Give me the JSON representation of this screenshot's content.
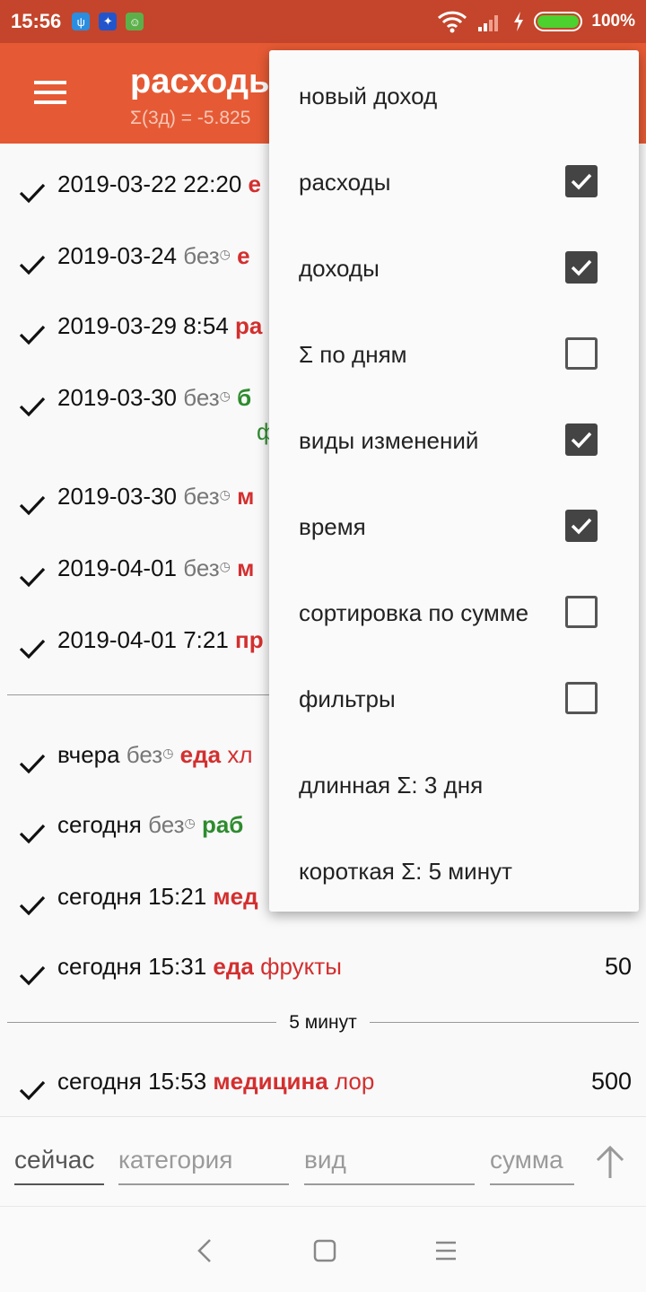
{
  "status_bar": {
    "time": "15:56",
    "battery": "100%"
  },
  "app_bar": {
    "title": "расходы",
    "subtitle": "Σ(3д) = -5.825"
  },
  "entries": [
    {
      "date": "2019-03-22 22:20",
      "note": "",
      "category": "е",
      "kind": "",
      "color": "red",
      "amount": ""
    },
    {
      "date": "2019-03-24",
      "note": "без",
      "category": "е",
      "kind": "",
      "color": "red",
      "amount": ""
    },
    {
      "date": "2019-03-29 8:54",
      "note": "",
      "category": "ра",
      "kind": "",
      "color": "red",
      "amount": ""
    },
    {
      "date": "2019-03-30",
      "note": "без",
      "category": "б",
      "kind": "",
      "color": "green",
      "amount": "",
      "wrap": "ф"
    },
    {
      "date": "2019-03-30",
      "note": "без",
      "category": "м",
      "kind": "",
      "color": "red",
      "amount": ""
    },
    {
      "date": "2019-04-01",
      "note": "без",
      "category": "м",
      "kind": "",
      "color": "red",
      "amount": ""
    },
    {
      "date": "2019-04-01 7:21",
      "note": "",
      "category": "пр",
      "kind": "",
      "color": "red",
      "amount": ""
    },
    {
      "date": "вчера",
      "note": "без",
      "category": "еда",
      "kind": "хл",
      "color": "red",
      "amount": ""
    },
    {
      "date": "сегодня",
      "note": "без",
      "category": "раб",
      "kind": "",
      "color": "green",
      "amount": ""
    },
    {
      "date": "сегодня 15:21",
      "note": "",
      "category": "мед",
      "kind": "",
      "color": "red",
      "amount": ""
    },
    {
      "date": "сегодня 15:31",
      "note": "",
      "category": "еда",
      "kind": "фрукты",
      "color": "red",
      "amount": "50"
    },
    {
      "date": "сегодня 15:53",
      "note": "",
      "category": "медицина",
      "kind": "лор",
      "color": "red",
      "amount": "500"
    }
  ],
  "divider_label": "5 минут",
  "input_bar": {
    "time": "сейчас",
    "category_placeholder": "категория",
    "kind_placeholder": "вид",
    "amount_placeholder": "сумма"
  },
  "menu": [
    {
      "label": "новый доход",
      "checkbox": null
    },
    {
      "label": "расходы",
      "checkbox": true
    },
    {
      "label": "доходы",
      "checkbox": true
    },
    {
      "label": "Σ по дням",
      "checkbox": false
    },
    {
      "label": "виды изменений",
      "checkbox": true
    },
    {
      "label": "время",
      "checkbox": true
    },
    {
      "label": "сортировка по сумме",
      "checkbox": false
    },
    {
      "label": "фильтры",
      "checkbox": false
    },
    {
      "label": "длинная Σ: 3 дня",
      "checkbox": null
    },
    {
      "label": "короткая Σ: 5 минут",
      "checkbox": null
    }
  ],
  "colors": {
    "status_bar": "#c4452b",
    "app_bar": "#e55a34",
    "expense": "#d32f2f",
    "income": "#2e8b2e"
  }
}
